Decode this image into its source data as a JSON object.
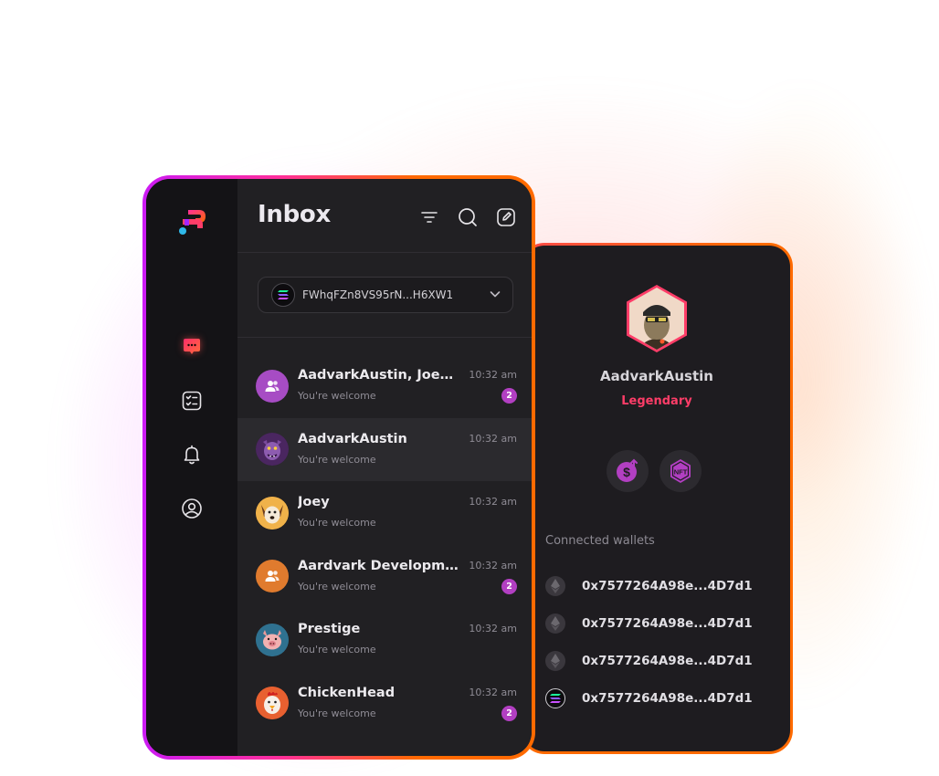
{
  "sidebar": {
    "items": [
      {
        "icon": "chat-icon",
        "active": true
      },
      {
        "icon": "checklist-icon",
        "active": false
      },
      {
        "icon": "bell-icon",
        "active": false
      },
      {
        "icon": "profile-icon",
        "active": false
      }
    ]
  },
  "inbox": {
    "title": "Inbox",
    "header_icons": [
      "filter-icon",
      "search-icon",
      "compose-icon"
    ],
    "wallet_selector": {
      "address": "FWhqFZn8VS95rN...H6XW1",
      "icon": "solana-icon"
    }
  },
  "conversations": [
    {
      "name": "AadvarkAustin, Joey...",
      "message": "You're welcome",
      "time": "10:32 am",
      "unread": "2",
      "avatar": "group-purple"
    },
    {
      "name": "AadvarkAustin",
      "message": "You're welcome",
      "time": "10:32 am",
      "unread": "",
      "avatar": "monster"
    },
    {
      "name": "Joey",
      "message": "You're welcome",
      "time": "10:32 am",
      "unread": "",
      "avatar": "dog"
    },
    {
      "name": "Aardvark Development",
      "message": "You're welcome",
      "time": "10:32 am",
      "unread": "2",
      "avatar": "group-orange"
    },
    {
      "name": "Prestige",
      "message": "You're welcome",
      "time": "10:32 am",
      "unread": "",
      "avatar": "pig"
    },
    {
      "name": "ChickenHead",
      "message": "You're welcome",
      "time": "10:32 am",
      "unread": "2",
      "avatar": "chicken"
    }
  ],
  "profile": {
    "name": "AadvarkAustin",
    "rank": "Legendary",
    "badges": [
      "dollar-badge-icon",
      "nft-badge-icon"
    ],
    "connected_wallets_title": "Connected wallets",
    "wallets": [
      {
        "address": "0x7577264A98e...4D7d1",
        "chain": "ethereum"
      },
      {
        "address": "0x7577264A98e...4D7d1",
        "chain": "ethereum"
      },
      {
        "address": "0x7577264A98e...4D7d1",
        "chain": "ethereum"
      },
      {
        "address": "0x7577264A98e...4D7d1",
        "chain": "solana"
      }
    ]
  },
  "colors": {
    "accent_pink": "#ff3d68",
    "accent_orange": "#ff6a00",
    "accent_purple": "#cc1bf5",
    "badge_purple": "#b23fc2"
  }
}
